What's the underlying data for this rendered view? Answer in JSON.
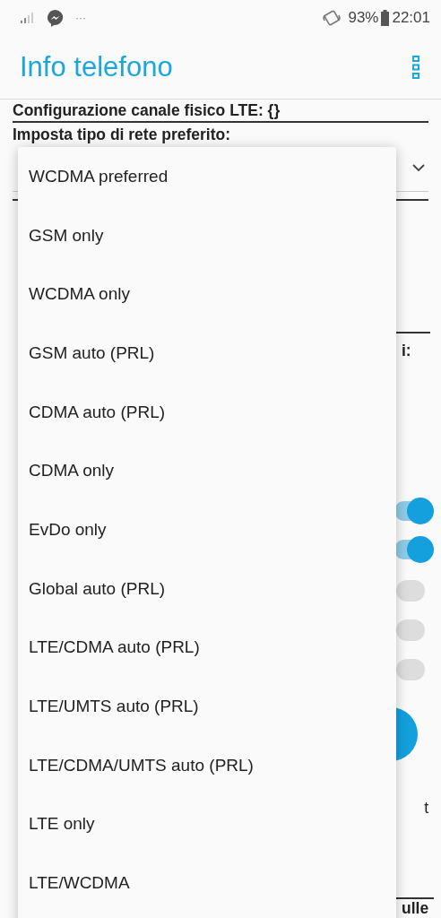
{
  "status_bar": {
    "more": "···",
    "battery": "93%",
    "time": "22:01"
  },
  "app_bar": {
    "title": "Info telefono"
  },
  "page": {
    "lte_config": "Configurazione canale fisico LTE: {}",
    "network_label": "Imposta tipo di rete preferito:",
    "peeking": [
      {
        "kind": "text",
        "text": "i:"
      },
      {
        "kind": "switch",
        "on": true
      },
      {
        "kind": "switch",
        "on": true
      },
      {
        "kind": "switch",
        "on": false
      },
      {
        "kind": "switch",
        "on": false
      },
      {
        "kind": "switch",
        "on": false
      },
      {
        "kind": "round-button"
      },
      {
        "kind": "text",
        "text": "t"
      },
      {
        "kind": "text",
        "text": "ulle"
      }
    ]
  },
  "network_menu": {
    "options": [
      "WCDMA preferred",
      "GSM only",
      "WCDMA only",
      "GSM auto (PRL)",
      "CDMA auto (PRL)",
      "CDMA only",
      "EvDo only",
      "Global auto (PRL)",
      "LTE/CDMA auto (PRL)",
      "LTE/UMTS auto (PRL)",
      "LTE/CDMA/UMTS auto (PRL)",
      "LTE only",
      "LTE/WCDMA"
    ]
  }
}
